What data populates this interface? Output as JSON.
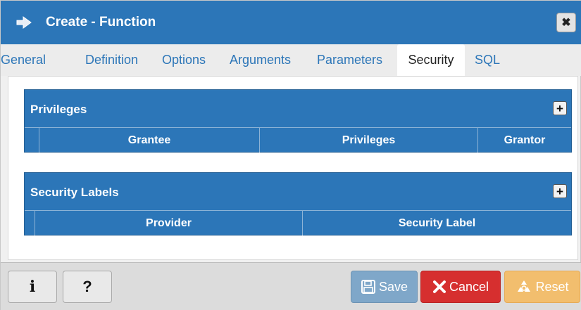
{
  "dialog": {
    "title": "Create - Function",
    "close_glyph": "✖"
  },
  "tabs": [
    {
      "label": "General"
    },
    {
      "label": "Definition"
    },
    {
      "label": "Options"
    },
    {
      "label": "Arguments"
    },
    {
      "label": "Parameters"
    },
    {
      "label": "Security",
      "active": true
    },
    {
      "label": "SQL"
    }
  ],
  "privileges": {
    "title": "Privileges",
    "add_glyph": "+",
    "columns": [
      "Grantee",
      "Privileges",
      "Grantor"
    ]
  },
  "security_labels": {
    "title": "Security Labels",
    "add_glyph": "+",
    "columns": [
      "Provider",
      "Security Label"
    ]
  },
  "footer": {
    "info_glyph": "i",
    "help_glyph": "?",
    "save_label": "Save",
    "cancel_label": "Cancel",
    "reset_label": "Reset"
  },
  "colors": {
    "primary": "#2c76b8",
    "save": "#7fa7c9",
    "cancel": "#d62f2f",
    "reset": "#f2be6e"
  },
  "icons": {
    "title": "arrow-right-icon",
    "save": "floppy-disk-icon",
    "cancel": "x-icon",
    "reset": "recycle-icon"
  }
}
